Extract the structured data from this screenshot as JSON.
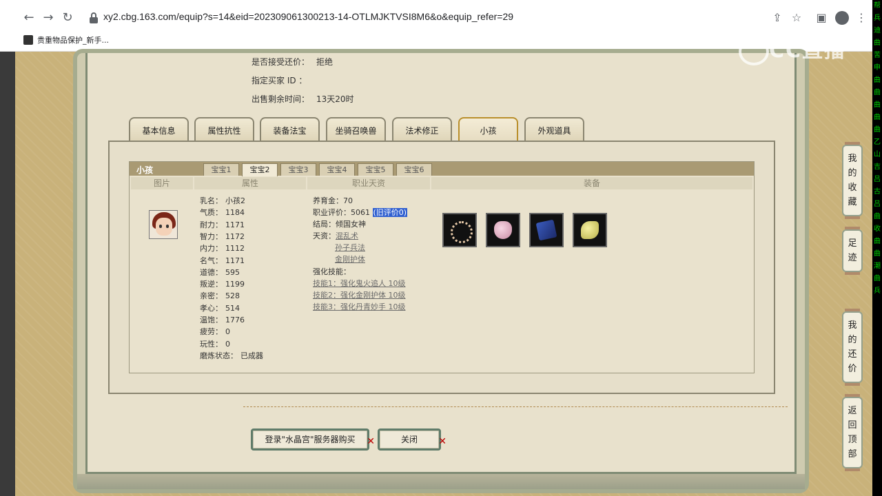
{
  "browser": {
    "url": "xy2.cbg.163.com/equip?s=14&eid=202309061300213-14-OTLMJKTVSI8M6&o&equip_refer=29",
    "bookmark": "贵重物品保护_新手..."
  },
  "watermark": "CC直播",
  "right_strip": [
    "帮",
    "兵",
    "迪",
    "曲",
    "苦",
    "申",
    "曲",
    "曲",
    "曲",
    "曲",
    "曲",
    "乙",
    "山",
    "吉",
    "吕",
    "古",
    "吕",
    "曲",
    "收",
    "曲",
    "曲",
    "潮",
    "曲",
    "兵"
  ],
  "info": [
    {
      "label": "是否接受还价：",
      "value": "拒绝"
    },
    {
      "label": "指定买家 ID ：",
      "value": ""
    },
    {
      "label": "出售剩余时间：",
      "value": "13天20时"
    }
  ],
  "tabs": [
    {
      "label": "基本信息"
    },
    {
      "label": "属性抗性"
    },
    {
      "label": "装备法宝"
    },
    {
      "label": "坐骑召唤兽"
    },
    {
      "label": "法术修正"
    },
    {
      "label": "小孩"
    },
    {
      "label": "外观道具"
    }
  ],
  "child_panel": {
    "title": "小孩",
    "subtabs": [
      "宝宝1",
      "宝宝2",
      "宝宝3",
      "宝宝4",
      "宝宝5",
      "宝宝6"
    ],
    "columns": [
      "图片",
      "属性",
      "职业天资",
      "装备"
    ],
    "attributes": [
      {
        "k": "乳名：",
        "v": "小孩2"
      },
      {
        "k": "气质：",
        "v": "1184"
      },
      {
        "k": "耐力：",
        "v": "1171"
      },
      {
        "k": "智力：",
        "v": "1172"
      },
      {
        "k": "内力：",
        "v": "1112"
      },
      {
        "k": "名气：",
        "v": "1171"
      },
      {
        "k": "道德：",
        "v": "595"
      },
      {
        "k": "叛逆：",
        "v": "1199"
      },
      {
        "k": "亲密：",
        "v": "528"
      },
      {
        "k": "孝心：",
        "v": "514"
      },
      {
        "k": "温饱：",
        "v": "1776"
      },
      {
        "k": "疲劳：",
        "v": "0"
      },
      {
        "k": "玩性：",
        "v": "0"
      },
      {
        "k": "磨炼状态：",
        "v": "已成器"
      }
    ],
    "career": {
      "fund_label": "养育金：",
      "fund": "70",
      "rating_label": "职业评价：",
      "rating": "5061",
      "rating_old": "(旧评价0)",
      "ending_label": "结局：",
      "ending": "倾国女神",
      "talent_label": "天资：",
      "talents": [
        "混乱术",
        "孙子兵法",
        "金刚护体"
      ],
      "skill_label": "强化技能：",
      "skills": [
        "技能1：强化鬼火追人 10级",
        "技能2：强化金刚护体 10级",
        "技能3：强化丹青妙手 10级"
      ]
    },
    "equipment": [
      "wreath-item-icon",
      "pouch-item-icon",
      "book-item-icon",
      "shoes-item-icon"
    ]
  },
  "buttons": {
    "buy": "登录\"水晶宫\"服务器购买",
    "close": "关闭"
  },
  "side_menu": [
    {
      "label": "我的收藏",
      "chars": [
        "我",
        "的",
        "收",
        "藏"
      ]
    },
    {
      "label": "足迹",
      "chars": [
        "足",
        "迹"
      ]
    },
    {
      "label": "我的还价",
      "chars": [
        "我",
        "的",
        "还",
        "价"
      ]
    },
    {
      "label": "返回顶部",
      "chars": [
        "返",
        "回",
        "顶",
        "部"
      ]
    }
  ]
}
